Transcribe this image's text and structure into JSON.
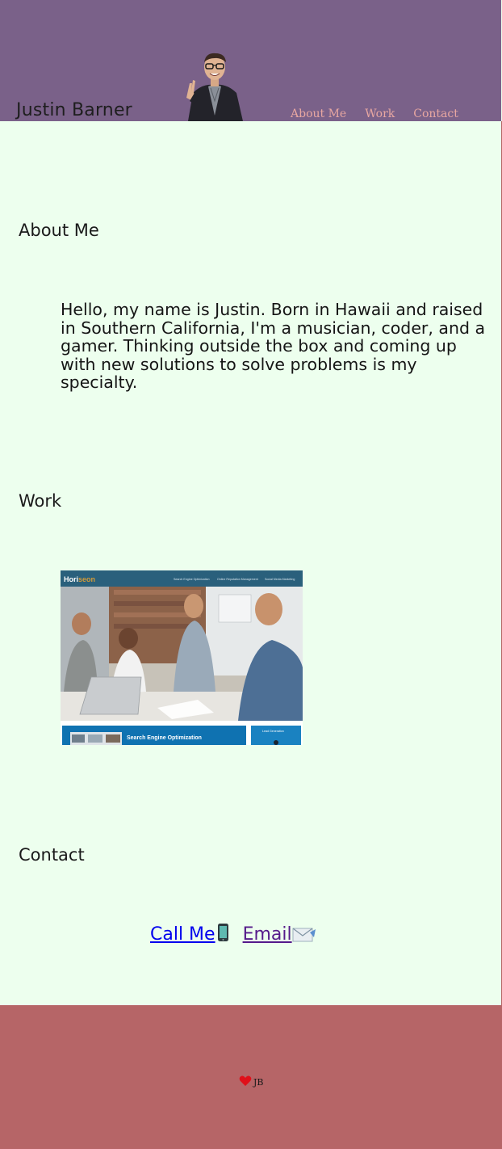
{
  "header": {
    "site_name": "Justin Barner",
    "nav": [
      {
        "label": "About Me"
      },
      {
        "label": "Work"
      },
      {
        "label": "Contact"
      }
    ]
  },
  "about": {
    "heading": "About Me",
    "body": "Hello, my name is Justin. Born in Hawaii and raised in Southern California, I'm a musician, coder, and a gamer. Thinking outside the box and coming up with new solutions to solve problems is my specialty."
  },
  "work": {
    "heading": "Work",
    "project": {
      "logo_prefix": "Hori",
      "logo_suffix": "seon",
      "nav": [
        "Search Engine Optimization",
        "Online Reputation Management",
        "Social Media Marketing"
      ],
      "feature_title": "Search Engine Optimization",
      "side_title": "Lead Generation"
    }
  },
  "contact": {
    "heading": "Contact",
    "call_label": "Call Me",
    "email_label": "Email"
  },
  "footer": {
    "initials": "JB"
  },
  "colors": {
    "header_bg": "#7a6189",
    "page_bg": "#edffee",
    "footer_bg": "#b66567",
    "nav_link": "#e8a7a1"
  },
  "icons": {
    "call": "mobile-phone-icon",
    "email": "envelope-icon",
    "footer": "heart-icon"
  }
}
